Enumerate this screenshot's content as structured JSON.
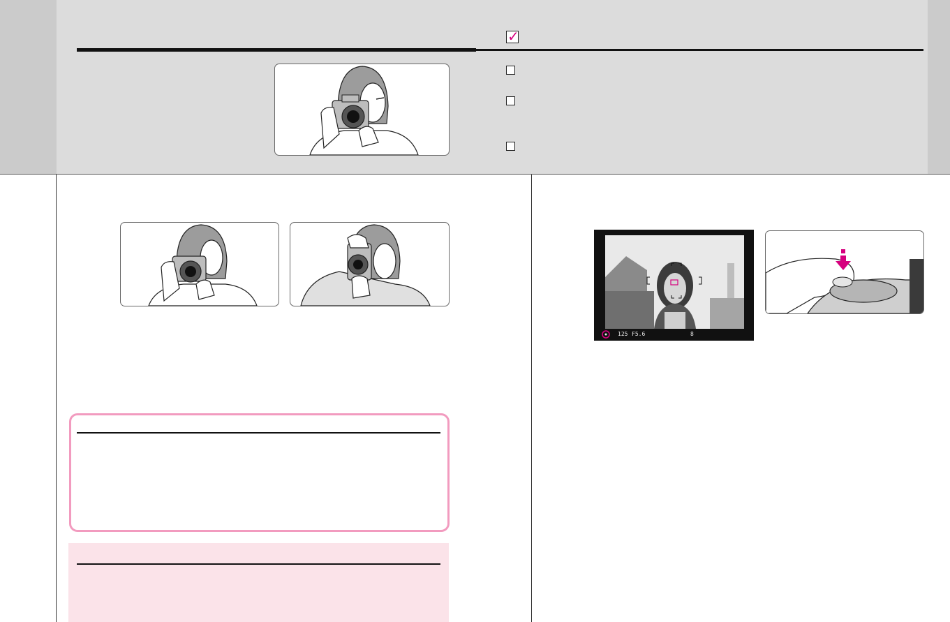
{
  "header": {
    "checklist": {
      "checked_icon": "checkmark-icon",
      "items": [
        "",
        "",
        ""
      ]
    }
  },
  "viewfinder": {
    "readout_shutter": "125",
    "readout_aperture": "F5.6",
    "readout_frames": "8"
  },
  "colors": {
    "accent": "#d6007e",
    "note_border": "#f29bbf",
    "caution_bg": "#fbe3e9",
    "band_bg": "#dcdcdc",
    "strip_bg": "#cbcbcb"
  },
  "icons": [
    "checkmark-icon",
    "checkbox-icon",
    "press-arrow-icon",
    "focus-brackets-icon"
  ]
}
